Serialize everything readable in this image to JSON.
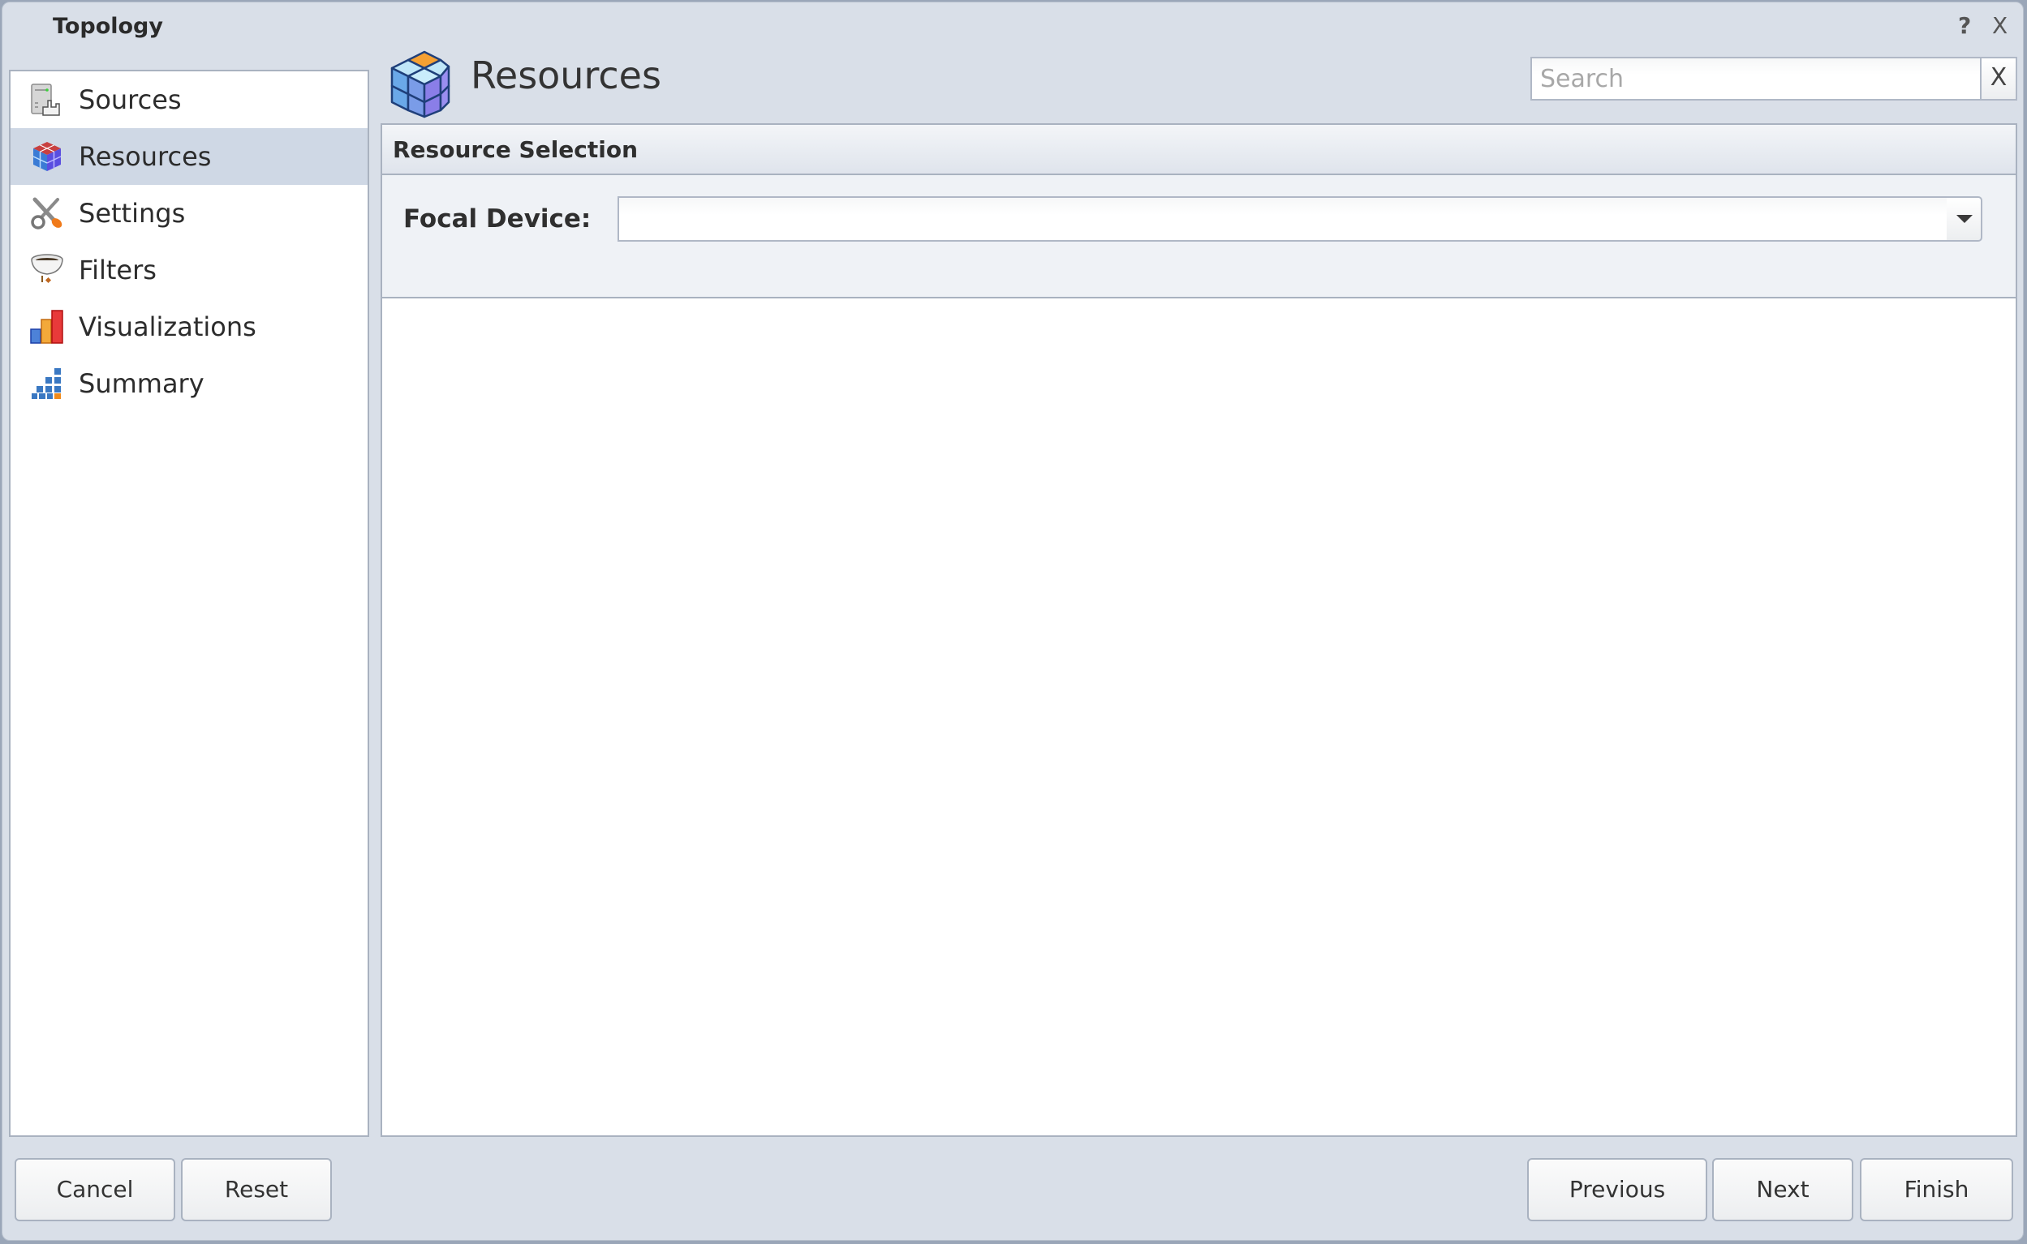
{
  "window": {
    "title": "Topology",
    "help_label": "?",
    "close_label": "X"
  },
  "sidebar": {
    "items": [
      {
        "label": "Sources",
        "icon": "server-icon",
        "active": false
      },
      {
        "label": "Resources",
        "icon": "cube-icon",
        "active": true
      },
      {
        "label": "Settings",
        "icon": "tools-icon",
        "active": false
      },
      {
        "label": "Filters",
        "icon": "funnel-icon",
        "active": false
      },
      {
        "label": "Visualizations",
        "icon": "bar-chart-icon",
        "active": false
      },
      {
        "label": "Summary",
        "icon": "summary-icon",
        "active": false
      }
    ]
  },
  "header": {
    "title": "Resources",
    "icon": "cube-icon"
  },
  "search": {
    "placeholder": "Search",
    "value": "",
    "clear_label": "X"
  },
  "section": {
    "title": "Resource Selection",
    "focal_device": {
      "label": "Focal Device:",
      "value": ""
    }
  },
  "footer": {
    "cancel": "Cancel",
    "reset": "Reset",
    "previous": "Previous",
    "next": "Next",
    "finish": "Finish"
  },
  "colors": {
    "window_bg": "#d9dfe8",
    "selected_item_bg": "#cfd8e5",
    "border": "#a9b2c0"
  }
}
